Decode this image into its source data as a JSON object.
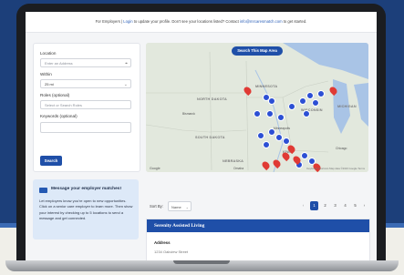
{
  "topbar": {
    "prefix": "For Employers |",
    "login": "Login",
    "middle": "to update your profile. Don't see your locations listed? Contact",
    "email": "info@mrcaresmatch.com",
    "suffix": "to get started."
  },
  "filters": {
    "location_label": "Location",
    "location_placeholder": "Enter an Address",
    "within_label": "Within",
    "within_value": "25 mi",
    "roles_label": "Roles (optional)",
    "roles_placeholder": "Select or Search Roles",
    "keywords_label": "Keywords (optional)",
    "keywords_value": "",
    "search_label": "Search"
  },
  "promo": {
    "title": "Message your employer matches!",
    "body": "Let employers know you're open to new opportunities. Click on a senior care employer to learn more. Then show your interest by checking up to 5 locations to send a message and get connected."
  },
  "map": {
    "search_area_label": "Search This Map Area",
    "regions": [
      "NORTH DAKOTA",
      "SOUTH DAKOTA",
      "MINNESOTA",
      "WISCONSIN",
      "IOWA",
      "NEBRASKA",
      "MICHIGAN"
    ],
    "cities": [
      "Bismarck",
      "Minneapolis",
      "Chicago",
      "Omaha"
    ],
    "footer_logo": "Google",
    "credit": "Keyboard shortcuts   Map data ©2023 Google   Terms"
  },
  "sort": {
    "label": "Sort By:",
    "value": "Name",
    "pages": [
      "1",
      "2",
      "3",
      "4",
      "5"
    ],
    "active_page": "1"
  },
  "result": {
    "title": "Serenity Assisted Living",
    "address_label": "Address",
    "address_value": "1234 Oakview Street"
  },
  "colors": {
    "brand": "#1f4fa8",
    "pin_blue": "#2c4fd4",
    "pin_red": "#e03a34"
  }
}
